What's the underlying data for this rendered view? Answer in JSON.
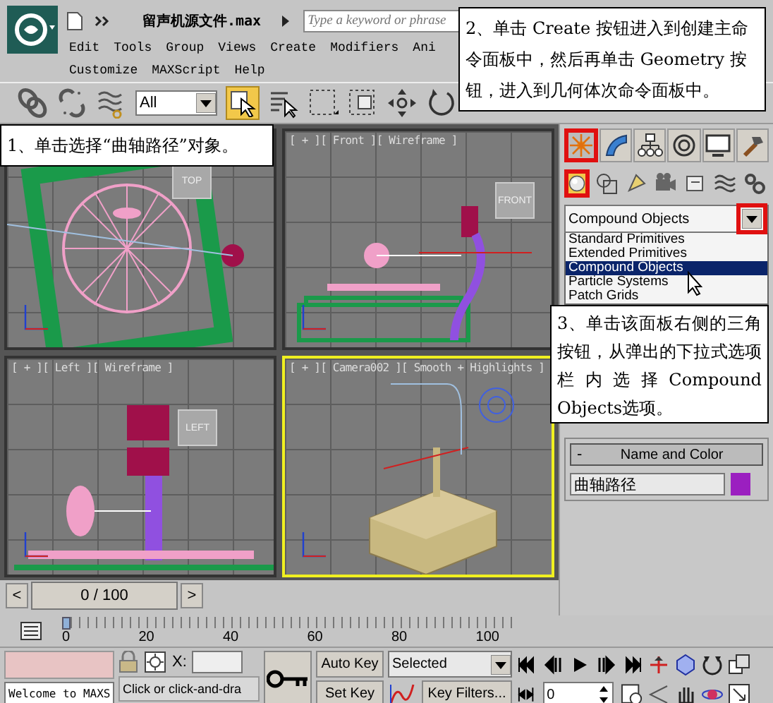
{
  "app": {
    "title": "留声机源文件.max",
    "search": {
      "placeholder": "Type a keyword or phrase"
    }
  },
  "menu_rows": [
    [
      "Edit",
      "Tools",
      "Group",
      "Views",
      "Create",
      "Modifiers",
      "Ani"
    ],
    [
      "Customize",
      "MAXScript",
      "Help"
    ]
  ],
  "toolbar": {
    "selection_filter": "All",
    "select_active": true
  },
  "viewports": [
    {
      "kind": "top",
      "cube_label": "TOP",
      "active": false
    },
    {
      "kind": "front",
      "label": "[ + ][ Front ][ Wireframe ]",
      "cube_label": "FRONT",
      "active": false
    },
    {
      "kind": "left",
      "label": "[ + ][ Left ][ Wireframe ]",
      "cube_label": "LEFT",
      "active": false
    },
    {
      "kind": "camera",
      "label": "[ + ][ Camera002 ][ Smooth + Highlights ]",
      "active": true
    }
  ],
  "command_panel": {
    "tabs": [
      {
        "kind": "create",
        "selected": true,
        "highlighted": true
      },
      {
        "kind": "modify",
        "selected": false,
        "highlighted": false
      },
      {
        "kind": "hierarchy",
        "selected": false,
        "highlighted": false
      },
      {
        "kind": "motion",
        "selected": false,
        "highlighted": false
      },
      {
        "kind": "display",
        "selected": false,
        "highlighted": false
      },
      {
        "kind": "utilities",
        "selected": false,
        "highlighted": false
      }
    ],
    "categories": [
      {
        "kind": "geometry",
        "selected": true,
        "highlighted": true
      },
      {
        "kind": "shapes",
        "selected": false,
        "highlighted": false
      },
      {
        "kind": "lights",
        "selected": false,
        "highlighted": false
      },
      {
        "kind": "cameras",
        "selected": false,
        "highlighted": false
      },
      {
        "kind": "helpers",
        "selected": false,
        "highlighted": false
      },
      {
        "kind": "spacewarps",
        "selected": false,
        "highlighted": false
      },
      {
        "kind": "systems",
        "selected": false,
        "highlighted": false
      }
    ],
    "dropdown": {
      "value": "Compound Objects",
      "arrow_highlighted": true,
      "options": [
        {
          "label": "Standard Primitives",
          "selected": false
        },
        {
          "label": "Extended Primitives",
          "selected": false
        },
        {
          "label": "Compound Objects",
          "selected": true
        },
        {
          "label": "Particle Systems",
          "selected": false
        },
        {
          "label": "Patch Grids",
          "selected": false
        }
      ]
    },
    "rollout": {
      "toggle": "-",
      "title": "Name and Color",
      "name": "曲轴路径",
      "color": "#9b1fc0"
    }
  },
  "time_slider": {
    "prev": "<",
    "reading": "0 / 100",
    "next": ">"
  },
  "track_bar": {
    "ticks": [
      "0",
      "20",
      "40",
      "60",
      "80",
      "100"
    ]
  },
  "status": {
    "prompt": "Welcome to MAXS",
    "x_label": "X:",
    "hint": "Click or click-and-dra",
    "auto_key": "Auto Key",
    "set_key": "Set Key",
    "key_mode": "Selected",
    "key_filters": "Key Filters...",
    "frame": "0"
  },
  "callouts": [
    {
      "text": "1、单击选择“曲轴路径”对象。"
    },
    {
      "text": "2、单击 Create 按钮进入到创建主命令面板中，然后再单击 Geometry 按钮，进入到几何体次命令面板中。"
    },
    {
      "text": "3、单击该面板右侧的三角按钮，从弹出的下拉式选项栏内选择Compound Objects选项。"
    }
  ]
}
